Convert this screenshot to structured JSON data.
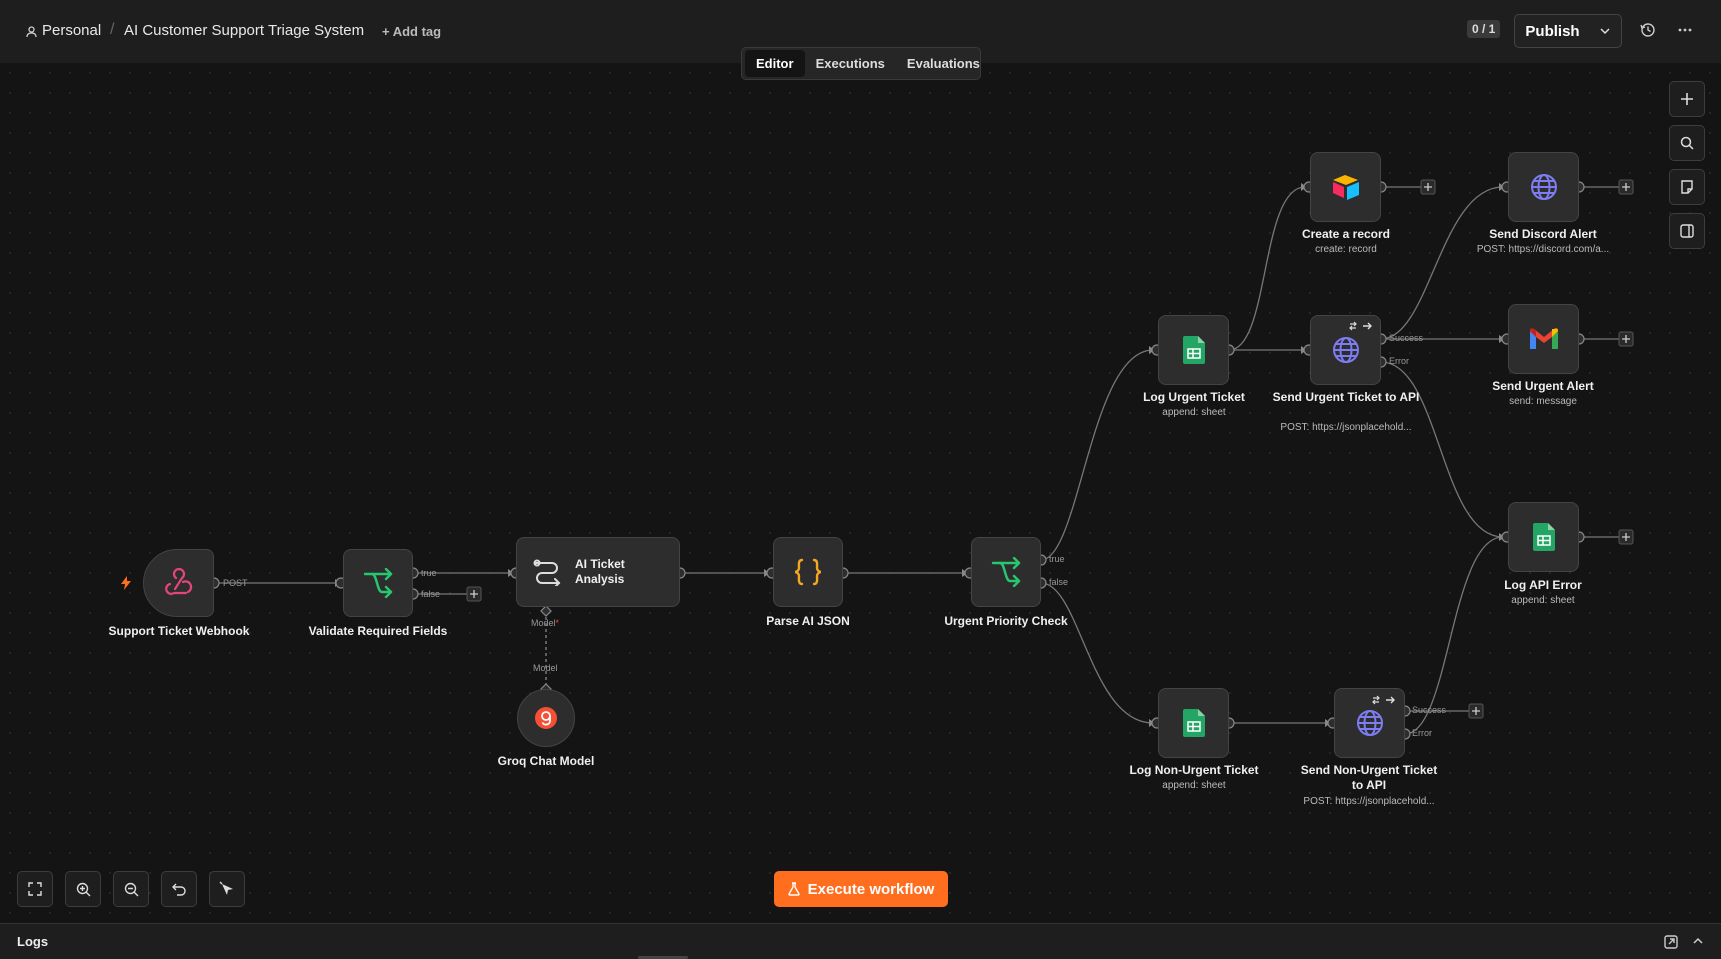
{
  "header": {
    "workspace": "Personal",
    "workflow_name": "AI Customer Support Triage System",
    "add_tag": "+ Add tag",
    "counter": "0 / 1",
    "publish_label": "Publish"
  },
  "tabs": [
    {
      "label": "Editor",
      "active": true
    },
    {
      "label": "Executions",
      "active": false
    },
    {
      "label": "Evaluations",
      "active": false
    }
  ],
  "nodes": {
    "webhook": {
      "label": "Support Ticket Webhook",
      "port": "POST"
    },
    "validate": {
      "label": "Validate Required Fields",
      "port_true": "true",
      "port_false": "false"
    },
    "ai": {
      "label": "AI Ticket Analysis",
      "port_model": "Model",
      "required_mark": "*"
    },
    "groq": {
      "label": "Groq Chat Model",
      "port_model": "Model"
    },
    "parse": {
      "label": "Parse AI JSON"
    },
    "urgent_check": {
      "label": "Urgent Priority Check",
      "port_true": "true",
      "port_false": "false"
    },
    "log_urgent": {
      "label": "Log Urgent Ticket",
      "sub": "append: sheet"
    },
    "create_record": {
      "label": "Create a record",
      "sub": "create: record"
    },
    "send_urgent_api": {
      "label": "Send Urgent Ticket to API",
      "sub": "POST: https://jsonplacehold...",
      "port_success": "Success",
      "port_error": "Error"
    },
    "discord": {
      "label": "Send Discord Alert",
      "sub": "POST: https://discord.com/a..."
    },
    "gmail": {
      "label": "Send Urgent Alert",
      "sub": "send: message"
    },
    "log_api_error": {
      "label": "Log API Error",
      "sub": "append: sheet"
    },
    "log_nonurgent": {
      "label": "Log Non-Urgent Ticket",
      "sub": "append: sheet"
    },
    "send_nonurgent_api": {
      "label": "Send Non-Urgent Ticket to API",
      "sub": "POST: https://jsonplacehold...",
      "port_success": "Success",
      "port_error": "Error"
    }
  },
  "execute_label": "Execute workflow",
  "logs_label": "Logs",
  "colors": {
    "accent": "#ff6d1f",
    "webhook": "#e4457a",
    "if_green": "#28c76f",
    "sheets_green": "#23a566",
    "http_blue": "#7d7cf0",
    "json_orange": "#f5a623",
    "groq": "#f55036"
  }
}
